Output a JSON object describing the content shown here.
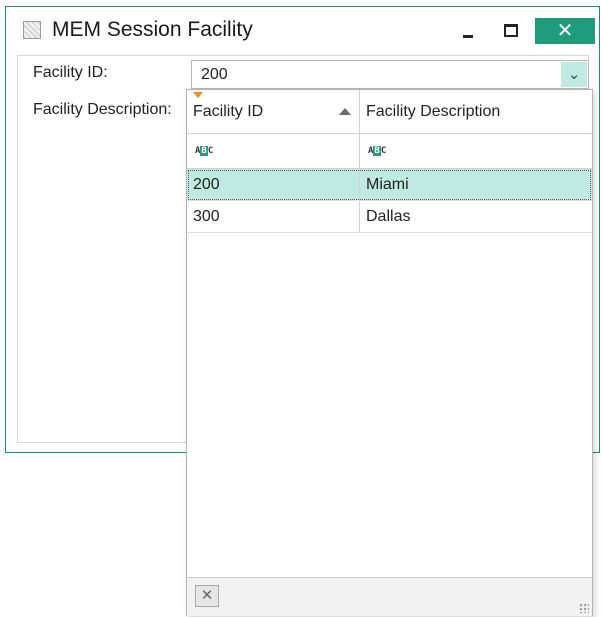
{
  "window": {
    "title": "MEM Session Facility",
    "minimize_icon": "minimize-icon",
    "maximize_icon": "maximize-icon",
    "close_glyph": "✕",
    "accent_color": "#1f9a7a"
  },
  "form": {
    "facility_id_label": "Facility ID:",
    "facility_description_label": "Facility Description:",
    "facility_id_value": "200",
    "dropdown_glyph": "⌄"
  },
  "dropdown_grid": {
    "columns": [
      {
        "label": "Facility ID",
        "sorted": "ascending",
        "filter_icon": "abc-text-filter-icon"
      },
      {
        "label": "Facility Description",
        "filter_icon": "abc-text-filter-icon"
      }
    ],
    "filter_icon_text": {
      "a": "A",
      "b": "B",
      "c": "C"
    },
    "rows": [
      {
        "id": "200",
        "description": "Miami",
        "selected": true
      },
      {
        "id": "300",
        "description": "Dallas",
        "selected": false
      }
    ],
    "selection_color": "#bfe9e1",
    "footer": {
      "clear_glyph": "✕"
    }
  }
}
